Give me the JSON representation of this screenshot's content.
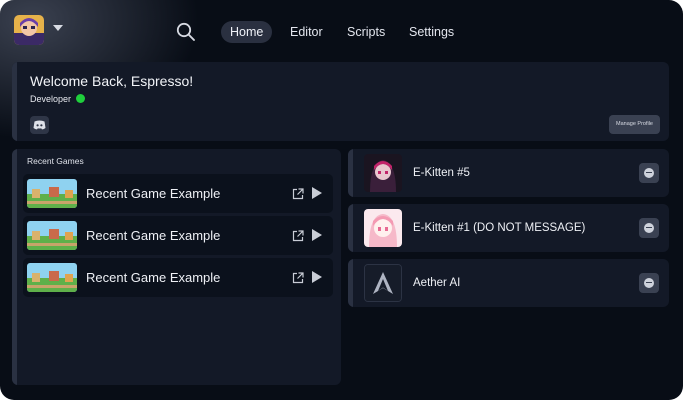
{
  "header": {
    "profile_menu_icon": "chevron-down-icon",
    "search_icon": "search-icon",
    "nav": [
      {
        "label": "Home",
        "active": true
      },
      {
        "label": "Editor",
        "active": false
      },
      {
        "label": "Scripts",
        "active": false
      },
      {
        "label": "Settings",
        "active": false
      }
    ]
  },
  "welcome": {
    "title": "Welcome Back, Espresso!",
    "role": "Developer",
    "status_color": "#1fcf3c",
    "discord_icon": "discord-icon",
    "manage_profile_label": "Manage Profile"
  },
  "recent_games": {
    "title": "Recent Games",
    "items": [
      {
        "name": "Recent Game Example"
      },
      {
        "name": "Recent Game Example"
      },
      {
        "name": "Recent Game Example"
      }
    ]
  },
  "contacts": [
    {
      "name": "E-Kitten #5",
      "avatar": "dark-anime-avatar"
    },
    {
      "name": "E-Kitten #1 (DO NOT MESSAGE)",
      "avatar": "pink-anime-avatar"
    },
    {
      "name": "Aether AI",
      "avatar": "aether-logo"
    }
  ],
  "colors": {
    "background": "#080d16",
    "card": "#131927",
    "accent_active_tab": "#2a3040",
    "online": "#1fcf3c"
  }
}
